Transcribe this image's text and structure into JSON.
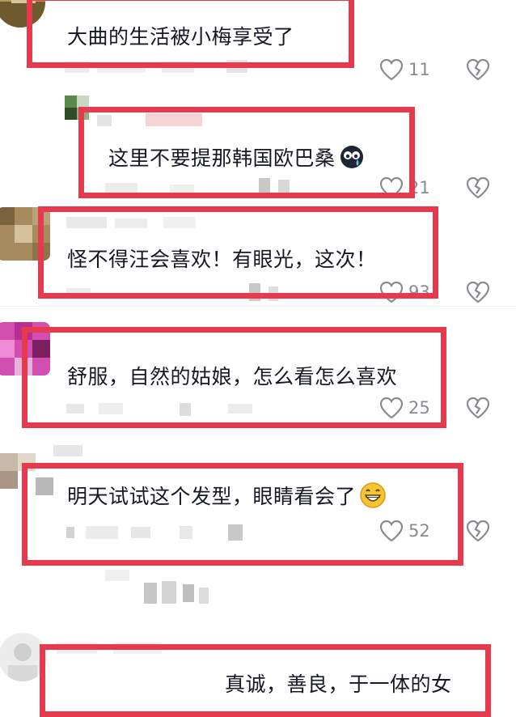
{
  "comments": [
    {
      "text": "大曲的生活被小梅享受了",
      "likes": "11"
    },
    {
      "text": "这里不要提那韩国欧巴桑",
      "likes": "21",
      "emoji": "crying-face-emoji"
    },
    {
      "text": "怪不得汪会喜欢！有眼光，这次！",
      "likes": "93"
    },
    {
      "text": "舒服，自然的姑娘，怎么看怎么喜欢",
      "likes": "25"
    },
    {
      "text": "明天试试这个发型，眼睛看会了",
      "likes": "52",
      "emoji": "grinning-face-emoji"
    },
    {
      "text": "真诚，善良，于一体的女"
    }
  ],
  "icons": {
    "like": "heart-outline-icon",
    "dislike": "broken-heart-icon"
  },
  "colors": {
    "highlight_box": "#e83a4f",
    "meta_gray": "#8a8b91"
  }
}
